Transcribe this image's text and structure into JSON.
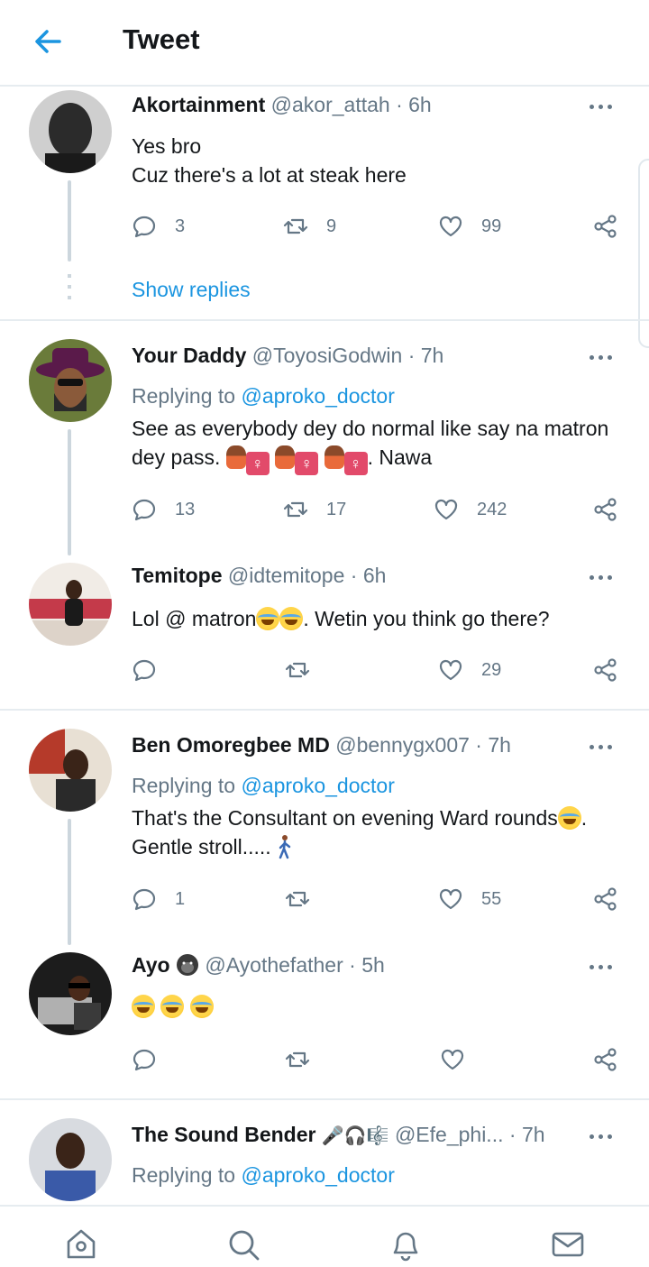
{
  "header": {
    "title": "Tweet"
  },
  "colors": {
    "accent": "#1b95e0",
    "secondary_text": "#657786",
    "divider": "#e6ecf0"
  },
  "tweets": [
    {
      "name": "Akortainment",
      "handle": "@akor_attah",
      "time": "6h",
      "replying_label": "",
      "replying_to": "",
      "text_lines": [
        "Yes bro",
        "Cuz there's a lot at steak here"
      ],
      "replies": "3",
      "retweets": "9",
      "likes": "99",
      "show_replies": "Show replies"
    },
    {
      "name": "Your Daddy",
      "handle": "@ToyosiGodwin",
      "time": "7h",
      "replying_label": "Replying to",
      "replying_to": "@aproko_doctor",
      "text_line1": "See as everybody dey do normal like say na matron",
      "text_line2_start": "dey pass.",
      "text_line2_end": ". Nawa",
      "replies": "13",
      "retweets": "17",
      "likes": "242"
    },
    {
      "name": "Temitope",
      "handle": "@idtemitope",
      "time": "6h",
      "text_start": "Lol @ matron",
      "text_end": ". Wetin you think go there?",
      "replies": "",
      "retweets": "",
      "likes": "29"
    },
    {
      "name": "Ben Omoregbee MD",
      "handle": "@bennygx007",
      "time": "7h",
      "replying_label": "Replying to",
      "replying_to": "@aproko_doctor",
      "text_line1": "That's the Consultant on evening Ward rounds",
      "text_line1_end": ".",
      "text_line2": "Gentle stroll.....",
      "replies": "1",
      "retweets": "",
      "likes": "55"
    },
    {
      "name": "Ayo",
      "handle": "@Ayothefather",
      "time": "5h",
      "replies": "",
      "retweets": "",
      "likes": ""
    },
    {
      "name": "The Sound Bender",
      "handle": "@Efe_phi...",
      "time": "7h",
      "replying_label": "Replying to",
      "replying_to": "@aproko_doctor"
    }
  ],
  "bottom_nav": [
    {
      "label": "Home",
      "icon": "home-icon"
    },
    {
      "label": "Search",
      "icon": "search-icon"
    },
    {
      "label": "Notifications",
      "icon": "bell-icon"
    },
    {
      "label": "Messages",
      "icon": "mail-icon"
    }
  ]
}
